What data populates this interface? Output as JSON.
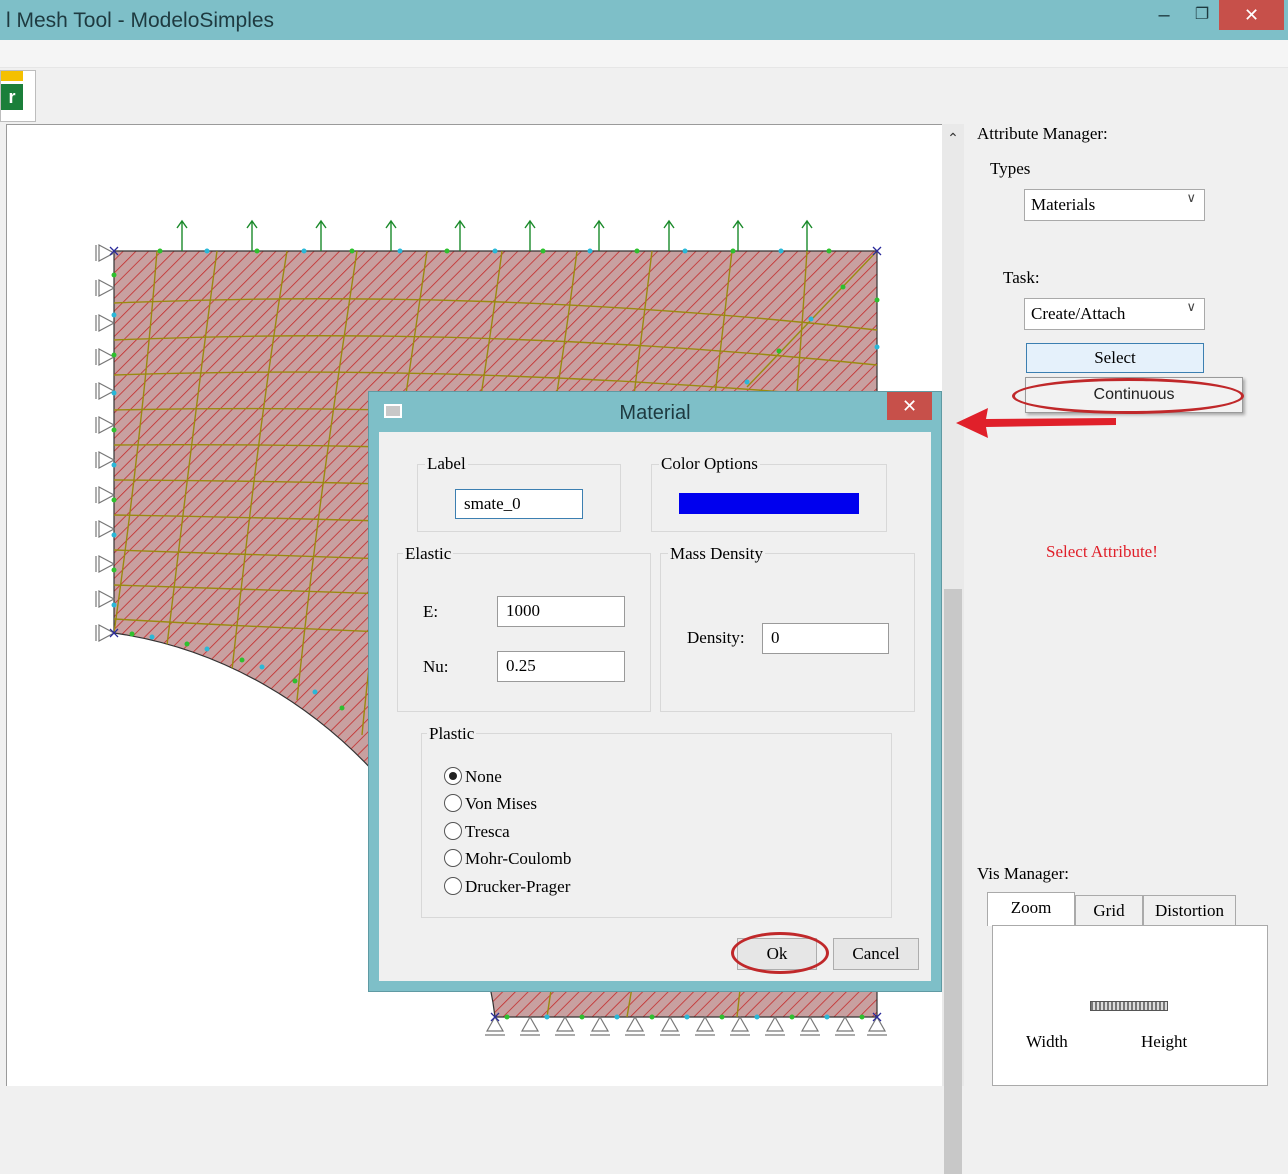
{
  "window": {
    "title": "l Mesh Tool - ModeloSimples",
    "minimize_glyph": "–",
    "maximize_glyph": "❐",
    "close_glyph": "✕"
  },
  "toolbar": {
    "app_icon": "app-logo-icon",
    "icon_letter": "r"
  },
  "canvas": {
    "scroll_up_glyph": "⌃"
  },
  "attribute_manager": {
    "heading": "Attribute Manager:",
    "types_label": "Types",
    "types_value": "Materials",
    "task_label": "Task:",
    "task_value": "Create/Attach",
    "select_button": "Select",
    "continuous_option": "Continuous",
    "status_message": "Select Attribute!",
    "status_color": "#e0202a"
  },
  "vis_manager": {
    "heading": "Vis Manager:",
    "tabs": [
      "Zoom",
      "Grid",
      "Distortion"
    ],
    "active_tab": "Zoom",
    "width_label": "Width",
    "height_label": "Height"
  },
  "material_dialog": {
    "title": "Material",
    "close_glyph": "✕",
    "label_group": "Label",
    "label_value": "smate_0",
    "color_group": "Color Options",
    "color_value": "#0000ee",
    "elastic_group": "Elastic",
    "e_label": "E:",
    "e_value": "1000",
    "nu_label": "Nu:",
    "nu_value": "0.25",
    "mass_group": "Mass Density",
    "density_label": "Density:",
    "density_value": "0",
    "plastic_group": "Plastic",
    "plastic_options": [
      "None",
      "Von Mises",
      "Tresca",
      "Mohr-Coulomb",
      "Drucker-Prager"
    ],
    "plastic_selected": "None",
    "ok_button": "Ok",
    "cancel_button": "Cancel"
  },
  "colors": {
    "titlebar": "#7ebfc8",
    "close_button": "#c7504a",
    "highlight_ellipse": "#c0282a",
    "mesh_fill": "#c8a0a0",
    "mesh_hatch": "#c42a2a",
    "mesh_lines": "#9a8a10",
    "load_arrows": "#1a8a2a"
  }
}
